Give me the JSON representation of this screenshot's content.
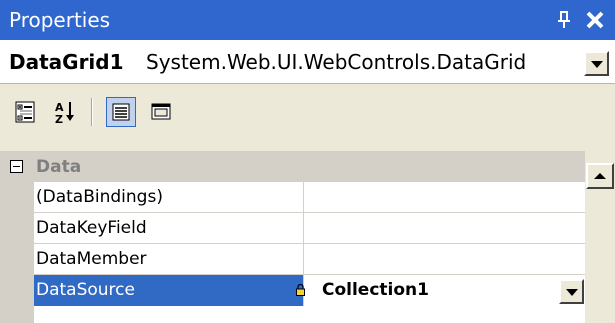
{
  "panel": {
    "title": "Properties",
    "pin_glyph": "ᴪ",
    "close_glyph": "✕"
  },
  "object_selector": {
    "name": "DataGrid1",
    "type": "System.Web.UI.WebControls.DataGrid"
  },
  "toolbar": {
    "buttons": [
      {
        "name": "categorized-button",
        "icon": "categorized-icon",
        "checked": false
      },
      {
        "name": "alphabetical-button",
        "icon": "alphabetical-icon",
        "checked": false
      },
      {
        "name": "properties-button",
        "icon": "properties-icon",
        "checked": true
      },
      {
        "name": "property-pages-button",
        "icon": "property-pages-icon",
        "checked": false
      }
    ]
  },
  "grid": {
    "category": {
      "label": "Data",
      "expanded": true
    },
    "properties": [
      {
        "name": "(DataBindings)",
        "value": ""
      },
      {
        "name": "DataKeyField",
        "value": ""
      },
      {
        "name": "DataMember",
        "value": ""
      },
      {
        "name": "DataSource",
        "value": "Collection1",
        "selected": true
      }
    ]
  },
  "colors": {
    "titlebar": "#2f67cf",
    "selection": "#316ac5",
    "toolbar": "#ece9d8",
    "gutter": "#d4d0c8"
  }
}
